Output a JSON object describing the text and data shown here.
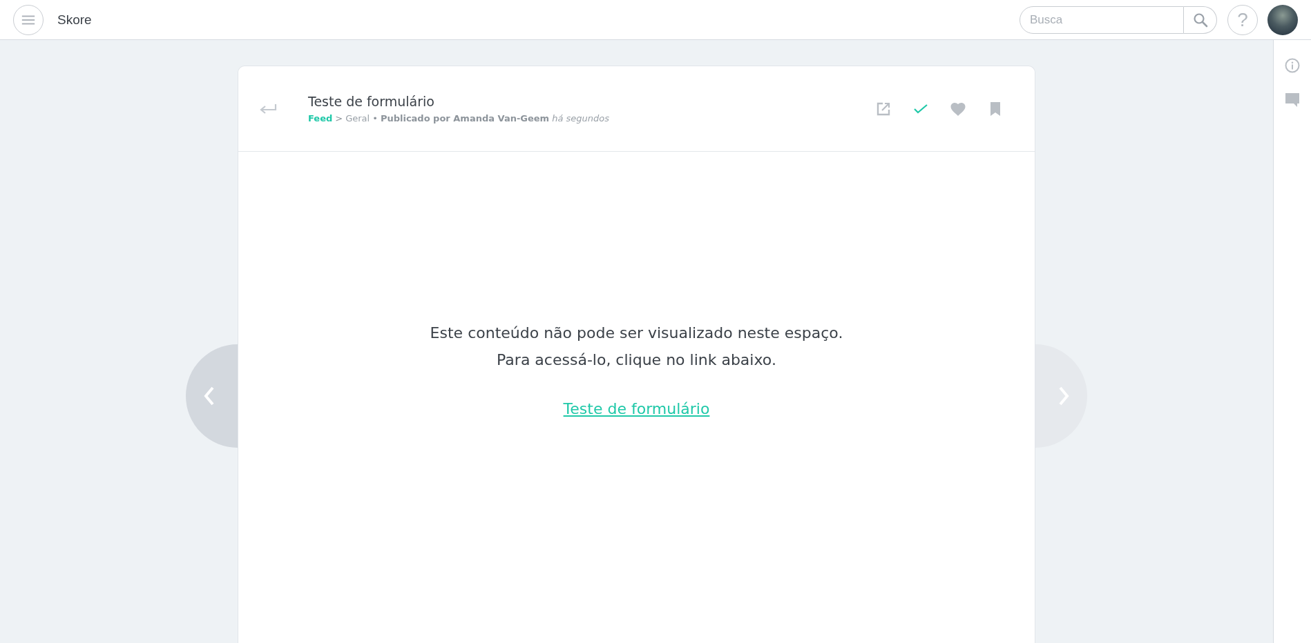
{
  "top_bar": {
    "app_name": "Skore",
    "search": {
      "placeholder": "Busca"
    },
    "help_label": "?"
  },
  "post": {
    "title": "Teste de formulário",
    "breadcrumb": {
      "section": "Feed",
      "separator": ">",
      "category": "Geral",
      "bullet": "•",
      "byline": "Publicado por Amanda Van-Geem",
      "time": "há segundos"
    },
    "actions": [
      {
        "kind": "open",
        "on": false
      },
      {
        "kind": "done",
        "on": true
      },
      {
        "kind": "like",
        "on": false
      },
      {
        "kind": "save",
        "on": false
      }
    ],
    "message_lines": [
      "Este conteúdo não pode ser visualizado neste espaço.",
      "Para acessá-lo, clique no link abaixo."
    ],
    "link": "Teste de formulário"
  },
  "navigation": [
    {
      "kind": "previous",
      "disabled": false
    },
    {
      "kind": "next",
      "disabled": true
    }
  ],
  "side_panel": [
    {
      "kind": "info"
    },
    {
      "kind": "comments"
    }
  ]
}
